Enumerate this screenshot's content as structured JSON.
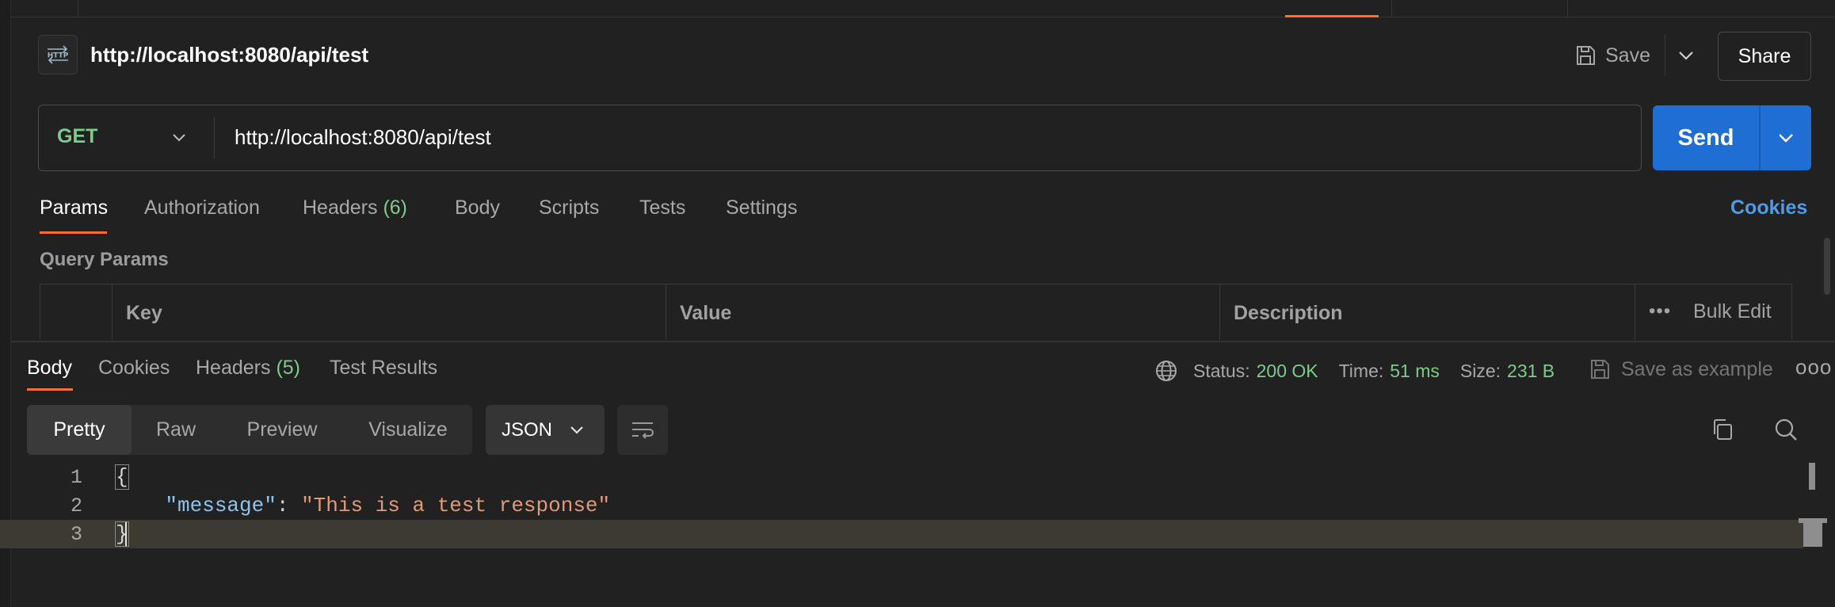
{
  "request": {
    "title": "http://localhost:8080/api/test",
    "badge_icon": "http-icon",
    "save_label": "Save",
    "share_label": "Share",
    "method": "GET",
    "url": "http://localhost:8080/api/test",
    "send_label": "Send"
  },
  "request_tabs": {
    "params": "Params",
    "authorization": "Authorization",
    "headers": "Headers",
    "headers_count": "(6)",
    "body": "Body",
    "scripts": "Scripts",
    "tests": "Tests",
    "settings": "Settings",
    "cookies": "Cookies"
  },
  "query_params": {
    "title": "Query Params",
    "columns": [
      "Key",
      "Value",
      "Description"
    ],
    "bulk_edit": "Bulk Edit"
  },
  "response_tabs": {
    "body": "Body",
    "cookies": "Cookies",
    "headers": "Headers",
    "headers_count": "(5)",
    "test_results": "Test Results"
  },
  "response_status": {
    "status_label": "Status:",
    "status_value": "200 OK",
    "time_label": "Time:",
    "time_value": "51 ms",
    "size_label": "Size:",
    "size_value": "231 B",
    "save_example": "Save as example"
  },
  "response_view": {
    "modes": [
      "Pretty",
      "Raw",
      "Preview",
      "Visualize"
    ],
    "selected_mode": "Pretty",
    "format": "JSON"
  },
  "code": {
    "line_numbers": [
      "1",
      "2",
      "3"
    ],
    "open_brace": "{",
    "key": "\"message\"",
    "colon": ": ",
    "value": "\"This is a test response\"",
    "close_brace": "}"
  },
  "colors": {
    "accent": "#ff6c37",
    "send": "#1f6ed4",
    "method": "#7dcc8a",
    "status_ok": "#7dcc8a",
    "link": "#4d9bec"
  }
}
